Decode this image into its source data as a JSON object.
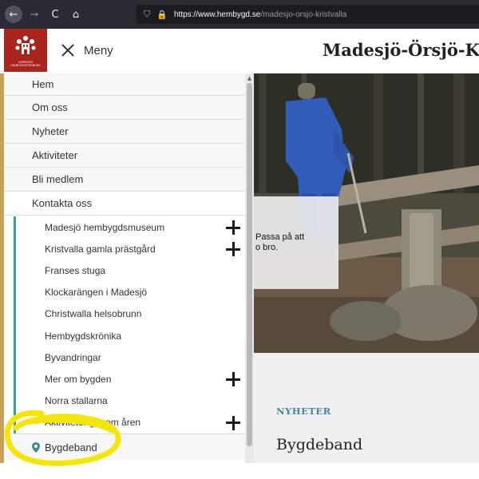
{
  "browser": {
    "url_host": "https://www.hembygd.se",
    "url_path": "/madesjo-orsjo-kristvalla",
    "back_icon": "←",
    "forward_icon": "→",
    "reload_icon": "C",
    "home_icon": "⌂"
  },
  "header": {
    "logo_text": "SVERIGES HEMBYGDSFÖRBUND",
    "menu_label": "Meny",
    "site_title": "Madesjö-Örsjö-K"
  },
  "nav": {
    "items": [
      {
        "label": "Hem"
      },
      {
        "label": "Om oss"
      },
      {
        "label": "Nyheter"
      },
      {
        "label": "Aktiviteter"
      },
      {
        "label": "Bli medlem"
      },
      {
        "label": "Kontakta oss"
      }
    ],
    "subitems": [
      {
        "label": "Madesjö hembygdsmuseum",
        "expandable": true
      },
      {
        "label": "Kristvalla gamla prästgård",
        "expandable": true
      },
      {
        "label": "Franses stuga",
        "expandable": false
      },
      {
        "label": "Klockarängen i Madesjö",
        "expandable": false
      },
      {
        "label": "Christwalla helsobrunn",
        "expandable": false
      },
      {
        "label": "Hembygdskrönika",
        "expandable": false
      },
      {
        "label": "Byvandringar",
        "expandable": false
      },
      {
        "label": "Mer om bygden",
        "expandable": true
      },
      {
        "label": "Norra stallarna",
        "expandable": false
      },
      {
        "label": "Aktiviteter genom åren",
        "expandable": true
      }
    ],
    "location_label": "Bygdeband"
  },
  "hero": {
    "caption_line1": "Passa på att",
    "caption_line2": "o bro."
  },
  "content": {
    "kicker": "NYHETER",
    "title": "Bygdeband"
  },
  "colors": {
    "brand_red": "#a8241c",
    "teal": "#3aa39a",
    "kicker": "#3a8b9a",
    "highlight": "#f5e60a"
  }
}
